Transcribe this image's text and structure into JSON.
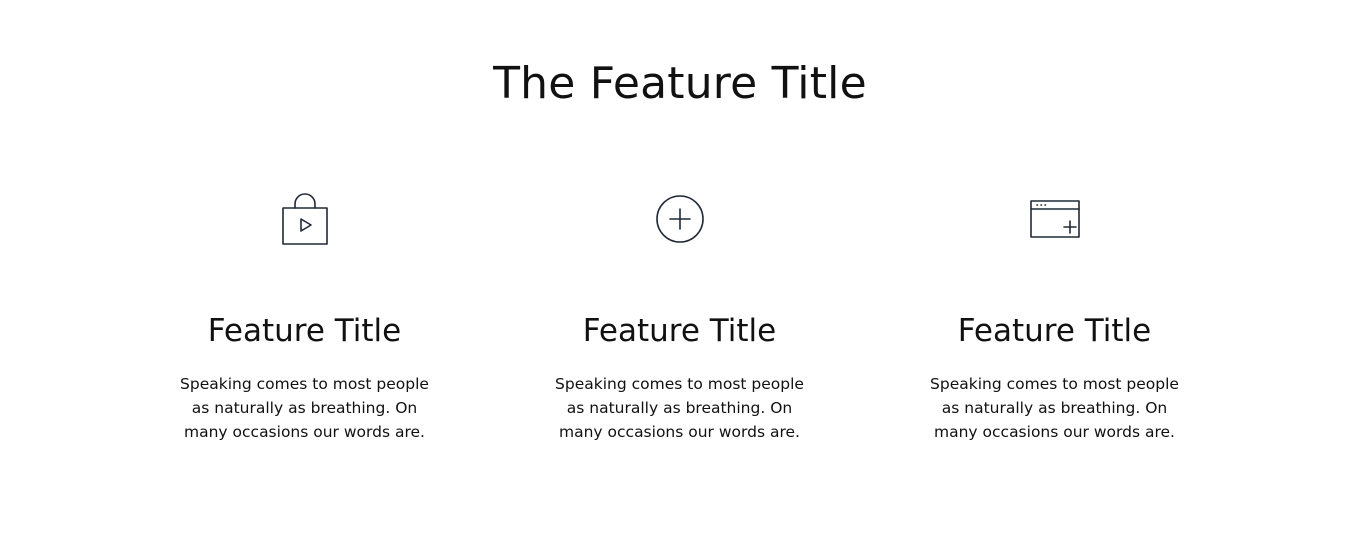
{
  "section": {
    "title": "The Feature Title"
  },
  "features": [
    {
      "icon": "shopping-bag-play-icon",
      "title": "Feature Title",
      "description": "Speaking comes to most people as naturally as breathing. On many occasions our words are."
    },
    {
      "icon": "circle-plus-icon",
      "title": "Feature Title",
      "description": "Speaking comes to most people as naturally as breathing. On many occasions our words are."
    },
    {
      "icon": "browser-window-add-icon",
      "title": "Feature Title",
      "description": "Speaking comes to most people as naturally as breathing. On many occasions our words are."
    }
  ],
  "colors": {
    "icon_stroke": "#1f2937",
    "text": "#111111",
    "background": "#ffffff"
  }
}
